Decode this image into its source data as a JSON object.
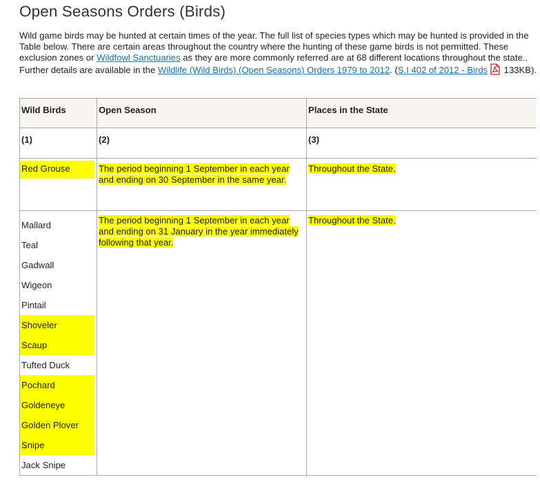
{
  "page": {
    "title": "Open Seasons Orders (Birds)",
    "intro_text_1": "Wild game birds may be hunted at certain times of the year. The full list of species types which may be hunted is provided in the Table below. There are certain areas throughout the country where the hunting of these game birds is not permitted. These exclusion zones or ",
    "intro_link_1": "Wildfowl Sanctuaries",
    "intro_text_2": " as they are more commonly referred are at 68 different locations throughout the state.. Further details are available in the ",
    "intro_link_2": "Wildlife (Wild Birds) (Open Seasons) Orders 1979 to 2012",
    "intro_text_3": ". (",
    "intro_link_3": "S.I 402 of 2012 - Birds",
    "pdf_icon": "pdf-file-icon",
    "intro_text_4": " 133KB)."
  },
  "table": {
    "headers": [
      "Wild Birds",
      "Open Season",
      "Places in the State"
    ],
    "column_numbers": [
      "(1)",
      "(2)",
      "(3)"
    ],
    "row1": {
      "bird": "Red Grouse",
      "season": "The period beginning 1 September in each year and ending on 30 September in the same year.",
      "places": "Throughout the State."
    },
    "row2": {
      "birds": [
        {
          "name": "Mallard",
          "highlighted": false
        },
        {
          "name": "Teal",
          "highlighted": false
        },
        {
          "name": "Gadwall",
          "highlighted": false
        },
        {
          "name": "Wigeon",
          "highlighted": false
        },
        {
          "name": "Pintail",
          "highlighted": false
        },
        {
          "name": "Shoveler",
          "highlighted": true
        },
        {
          "name": "Scaup",
          "highlighted": true
        },
        {
          "name": "Tufted Duck",
          "highlighted": false
        },
        {
          "name": "Pochard",
          "highlighted": true
        },
        {
          "name": "Goldeneye",
          "highlighted": true
        },
        {
          "name": "Golden Plover",
          "highlighted": true
        },
        {
          "name": "Snipe",
          "highlighted": true
        },
        {
          "name": "Jack Snipe",
          "highlighted": false
        }
      ],
      "season": "The period beginning 1 September in each year and ending on 31 January in the year immediately following that year.",
      "places": "Throughout the State."
    }
  },
  "colors": {
    "highlight": "#ffff00",
    "link": "#1a6fb0",
    "header_bg": "#f7f6ee",
    "border": "#a9a9a9"
  }
}
